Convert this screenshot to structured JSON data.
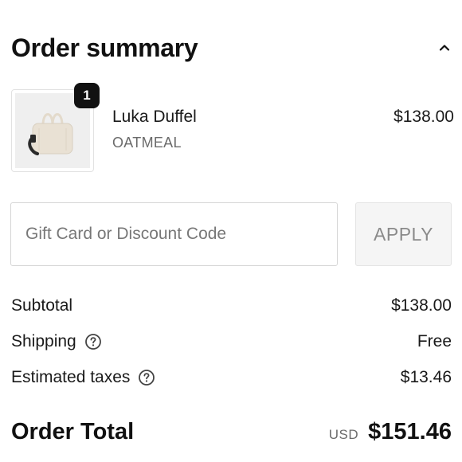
{
  "header": {
    "title": "Order summary",
    "collapse_icon": "chevron-up-icon"
  },
  "line_item": {
    "quantity": "1",
    "name": "Luka Duffel",
    "variant": "OATMEAL",
    "price": "$138.00",
    "image_icon": "duffel-bag-image"
  },
  "discount": {
    "placeholder": "Gift Card or Discount Code",
    "value": "",
    "apply_label": "APPLY"
  },
  "totals": {
    "subtotal_label": "Subtotal",
    "subtotal_value": "$138.00",
    "shipping_label": "Shipping",
    "shipping_value": "Free",
    "taxes_label": "Estimated taxes",
    "taxes_value": "$13.46",
    "help_icon": "question-circle-icon"
  },
  "order_total": {
    "label": "Order Total",
    "currency": "USD",
    "value": "$151.46"
  },
  "colors": {
    "text": "#111111",
    "muted": "#6b6b6b",
    "border": "#d6d6d6",
    "apply_bg": "#f5f5f5",
    "badge_bg": "#111111",
    "product_cream": "#e9e1d4",
    "product_strap": "#2a2a2a"
  }
}
